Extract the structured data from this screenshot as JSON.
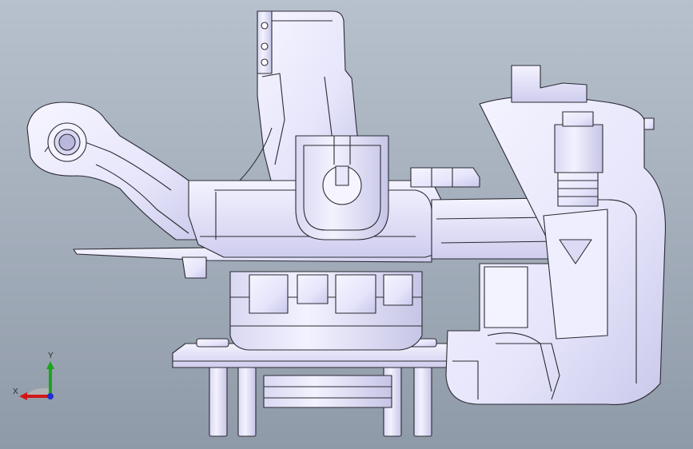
{
  "viewport": {
    "background_top": "#b7c1cd",
    "background_bottom": "#8f9aa8"
  },
  "model": {
    "fill": "#ecebff",
    "shade": "#c9c8ea",
    "dark_shade": "#a9a8d2",
    "edge": "#2b2b33"
  },
  "triad": {
    "x_label": "X",
    "y_label": "Y",
    "x_color": "#d01818",
    "y_color": "#1aa51a",
    "z_color": "#2030d0",
    "icon": "coordinate-triad-icon"
  }
}
